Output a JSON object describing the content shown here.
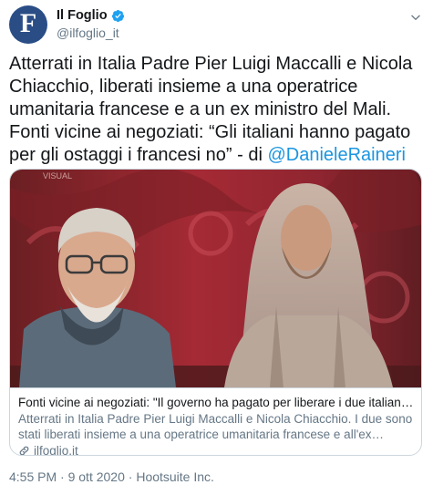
{
  "account": {
    "display_name": "Il Foglio",
    "handle": "@ilfoglio_it",
    "avatar_letter": "F",
    "avatar_color": "#2a4d86",
    "verified": true
  },
  "tweet": {
    "text": "Atterrati in Italia Padre Pier Luigi Maccalli e Nicola Chiacchio, liberati insieme a una operatrice umanitaria francese e a un ex ministro del Mali. Fonti vicine ai negoziati: “Gli italiani hanno pagato per gli ostaggi i francesi no” - di ",
    "mention": "@DanieleRaineri"
  },
  "card": {
    "image_watermark": "VISUAL",
    "title": "Fonti vicine ai negoziati: \"Il governo ha pagato per liberare i due italiani sequestr...",
    "description": "Atterrati in Italia Padre Pier Luigi Maccalli e Nicola Chiacchio. I due sono stati liberati insieme a una operatrice umanitaria francese e all'ex ministro malian...",
    "domain": "ilfoglio.it"
  },
  "meta": {
    "time": "4:55 PM",
    "separator": "·",
    "date": "9 ott 2020",
    "source": "Hootsuite Inc."
  },
  "colors": {
    "link": "#1b95e0",
    "secondary_text": "#657786",
    "border": "#ccd6dd",
    "verified_badge": "#1da1f2"
  }
}
